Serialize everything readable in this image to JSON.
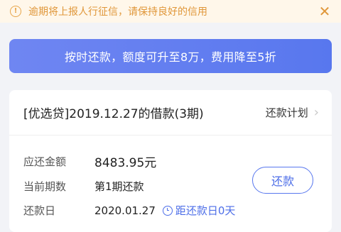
{
  "notice": {
    "text": "逾期将上报人行征信，请保持良好的信用",
    "warn_icon": "!",
    "close_icon": "✕"
  },
  "banner": {
    "text": "按时还款，额度可升至8万，费用降至5折"
  },
  "loan": {
    "title": "[优选贷]2019.12.27的借款(3期)",
    "plan_label": "还款计划",
    "chevron": "›",
    "amount_label": "应还金额",
    "amount_value": "8483.95元",
    "period_label": "当前期数",
    "period_value": "第1期还款",
    "due_label": "还款日",
    "due_value": "2020.01.27",
    "due_countdown": "距还款日0天",
    "repay_label": "还款"
  }
}
